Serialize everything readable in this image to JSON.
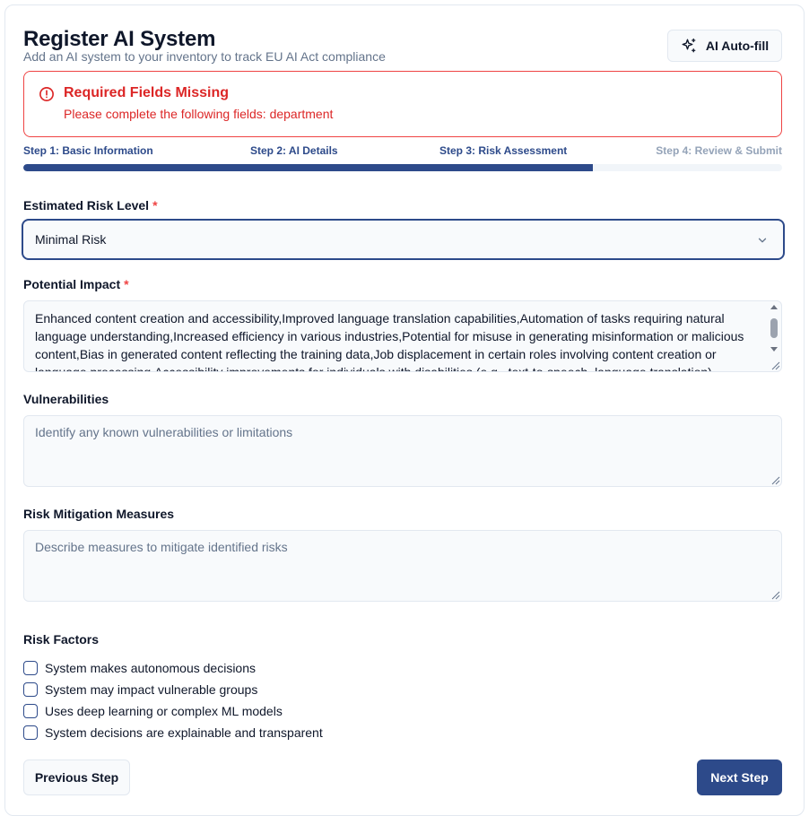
{
  "header": {
    "title": "Register AI System",
    "subtitle": "Add an AI system to your inventory to track EU AI Act compliance",
    "autofill_label": "AI Auto-fill"
  },
  "alert": {
    "title": "Required Fields Missing",
    "message": "Please complete the following fields: department"
  },
  "steps": [
    {
      "label": "Step 1: Basic Information",
      "state": "complete"
    },
    {
      "label": "Step 2: AI Details",
      "state": "complete"
    },
    {
      "label": "Step 3: Risk Assessment",
      "state": "current"
    },
    {
      "label": "Step 4: Review & Submit",
      "state": "pending"
    }
  ],
  "progress_fraction": 0.75,
  "form": {
    "risk_level": {
      "label": "Estimated Risk Level",
      "required_mark": "*",
      "value": "Minimal Risk"
    },
    "impact": {
      "label": "Potential Impact",
      "required_mark": "*",
      "value": "Enhanced content creation and accessibility,Improved language translation capabilities,Automation of tasks requiring natural language understanding,Increased efficiency in various industries,Potential for misuse in generating misinformation or malicious content,Bias in generated content reflecting the training data,Job displacement in certain roles involving content creation or language processing,Accessibility improvements for individuals with disabilities (e.g., text-to-speech, language translation)"
    },
    "vulnerabilities": {
      "label": "Vulnerabilities",
      "placeholder": "Identify any known vulnerabilities or limitations"
    },
    "mitigation": {
      "label": "Risk Mitigation Measures",
      "placeholder": "Describe measures to mitigate identified risks"
    },
    "risk_factors": {
      "label": "Risk Factors",
      "items": [
        {
          "label": "System makes autonomous decisions",
          "checked": false
        },
        {
          "label": "System may impact vulnerable groups",
          "checked": false
        },
        {
          "label": "Uses deep learning or complex ML models",
          "checked": false
        },
        {
          "label": "System decisions are explainable and transparent",
          "checked": false
        }
      ]
    }
  },
  "footer": {
    "prev_label": "Previous Step",
    "next_label": "Next Step"
  },
  "colors": {
    "primary": "#2d4a8a",
    "error": "#dc2626",
    "muted": "#94a3b8"
  },
  "icons": {
    "autofill": "sparkles-icon",
    "alert": "alert-circle-icon",
    "select": "chevron-down-icon"
  }
}
